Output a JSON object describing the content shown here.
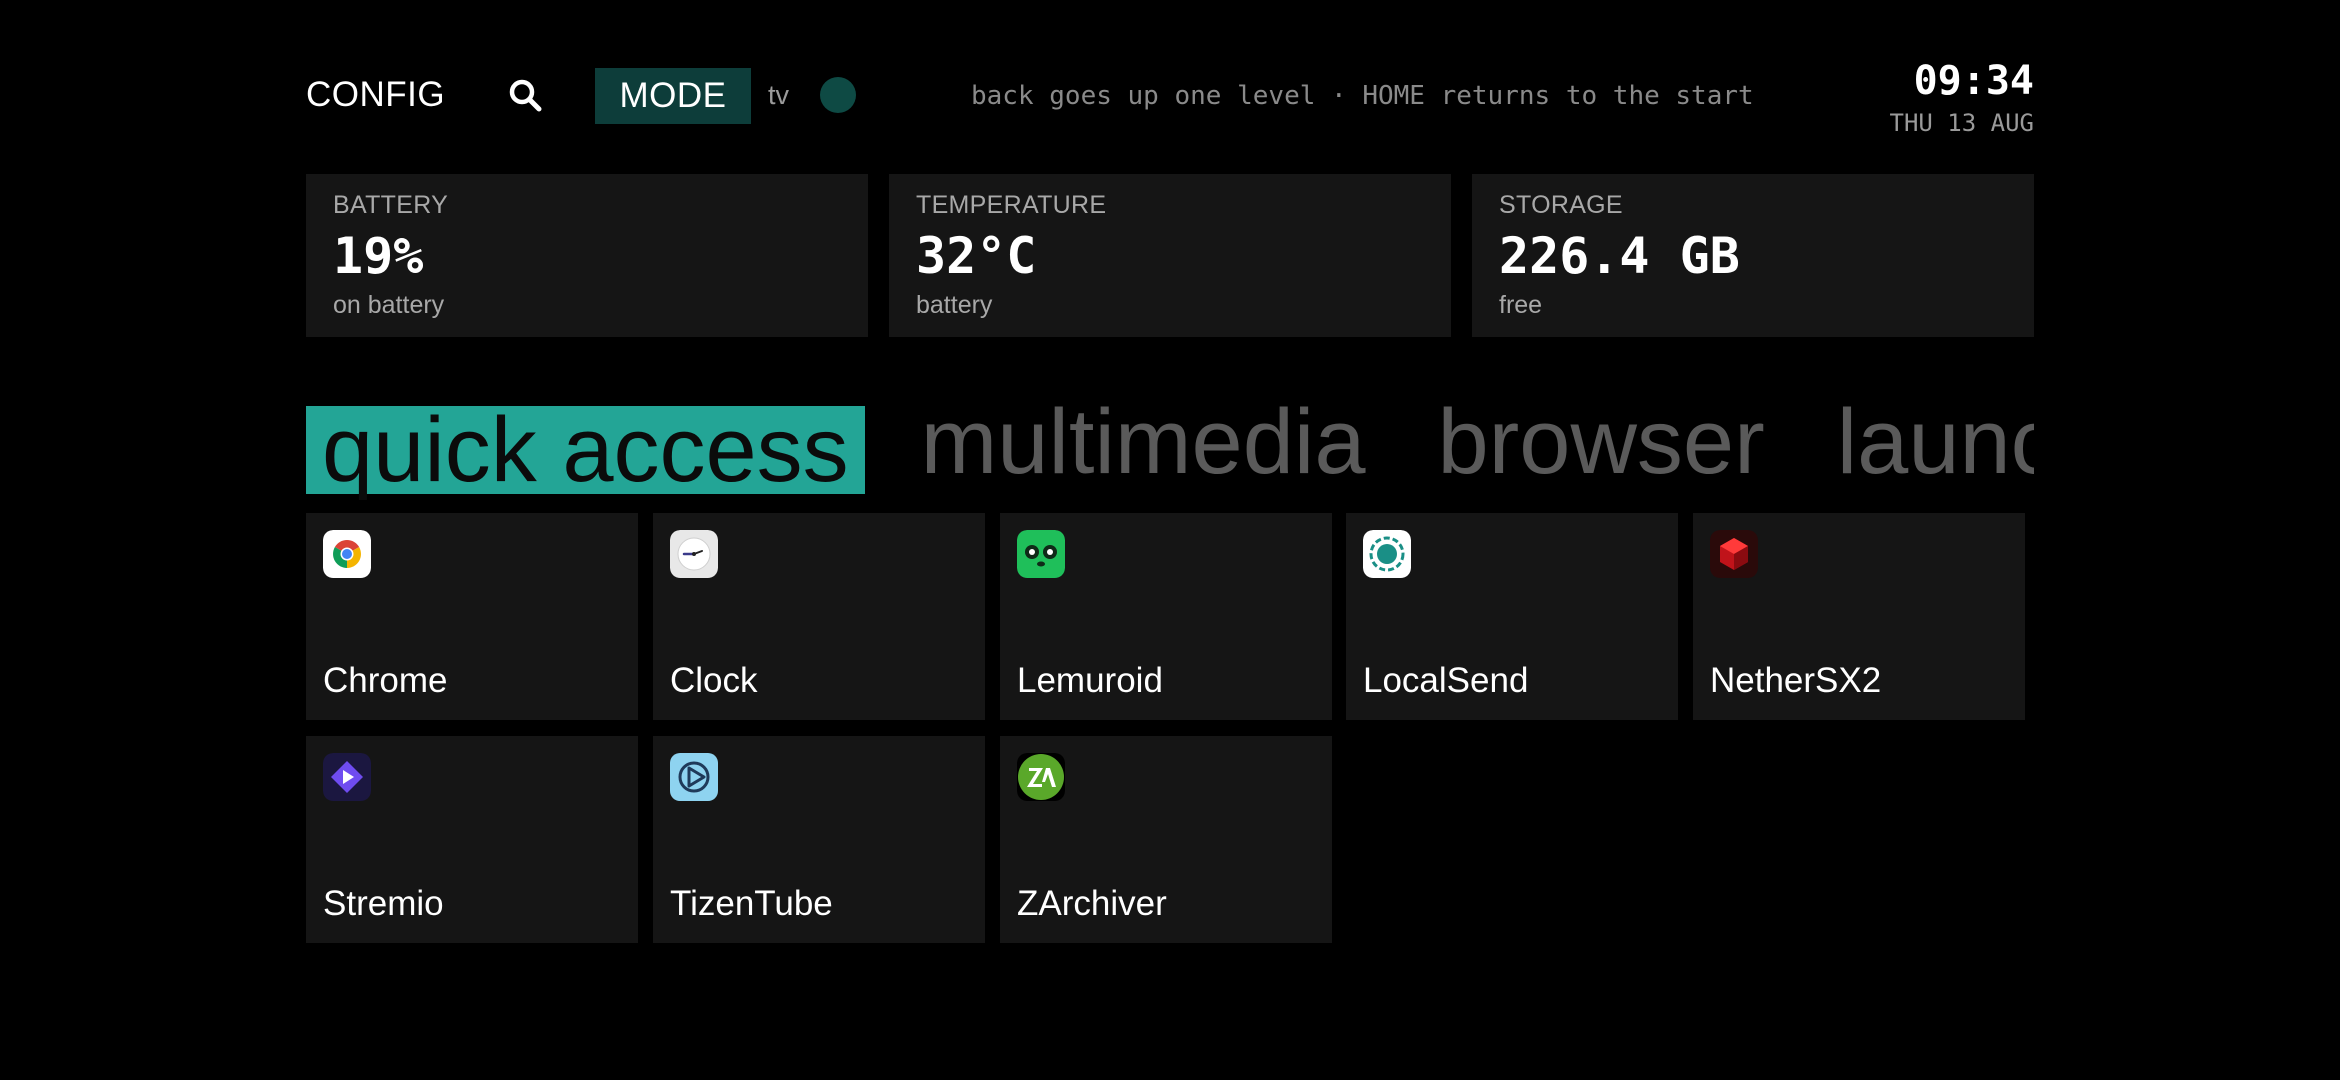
{
  "topbar": {
    "config_label": "CONFIG",
    "mode_label": "MODE",
    "mode_value": "tv",
    "hint": "back goes up one level · HOME returns to the start",
    "time": "09:34",
    "date": "THU 13 AUG"
  },
  "stats": [
    {
      "label": "BATTERY",
      "value": "19%",
      "sub": "on battery"
    },
    {
      "label": "TEMPERATURE",
      "value": "32°C",
      "sub": "battery"
    },
    {
      "label": "STORAGE",
      "value": "226.4 GB",
      "sub": "free"
    }
  ],
  "tabs": [
    "quick access",
    "multimedia",
    "browser",
    "launchers"
  ],
  "active_tab": "quick access",
  "apps": [
    {
      "name": "Chrome",
      "icon": "chrome-icon"
    },
    {
      "name": "Clock",
      "icon": "clock-icon"
    },
    {
      "name": "Lemuroid",
      "icon": "lemuroid-icon"
    },
    {
      "name": "LocalSend",
      "icon": "localsend-icon"
    },
    {
      "name": "NetherSX2",
      "icon": "nethersx2-icon"
    },
    {
      "name": "Stremio",
      "icon": "stremio-icon"
    },
    {
      "name": "TizenTube",
      "icon": "tizentube-icon"
    },
    {
      "name": "ZArchiver",
      "icon": "zarchiver-icon"
    }
  ],
  "colors": {
    "background": "#000000",
    "card": "#151515",
    "accent": "#23a596",
    "mode_button": "#0d3d3a"
  }
}
